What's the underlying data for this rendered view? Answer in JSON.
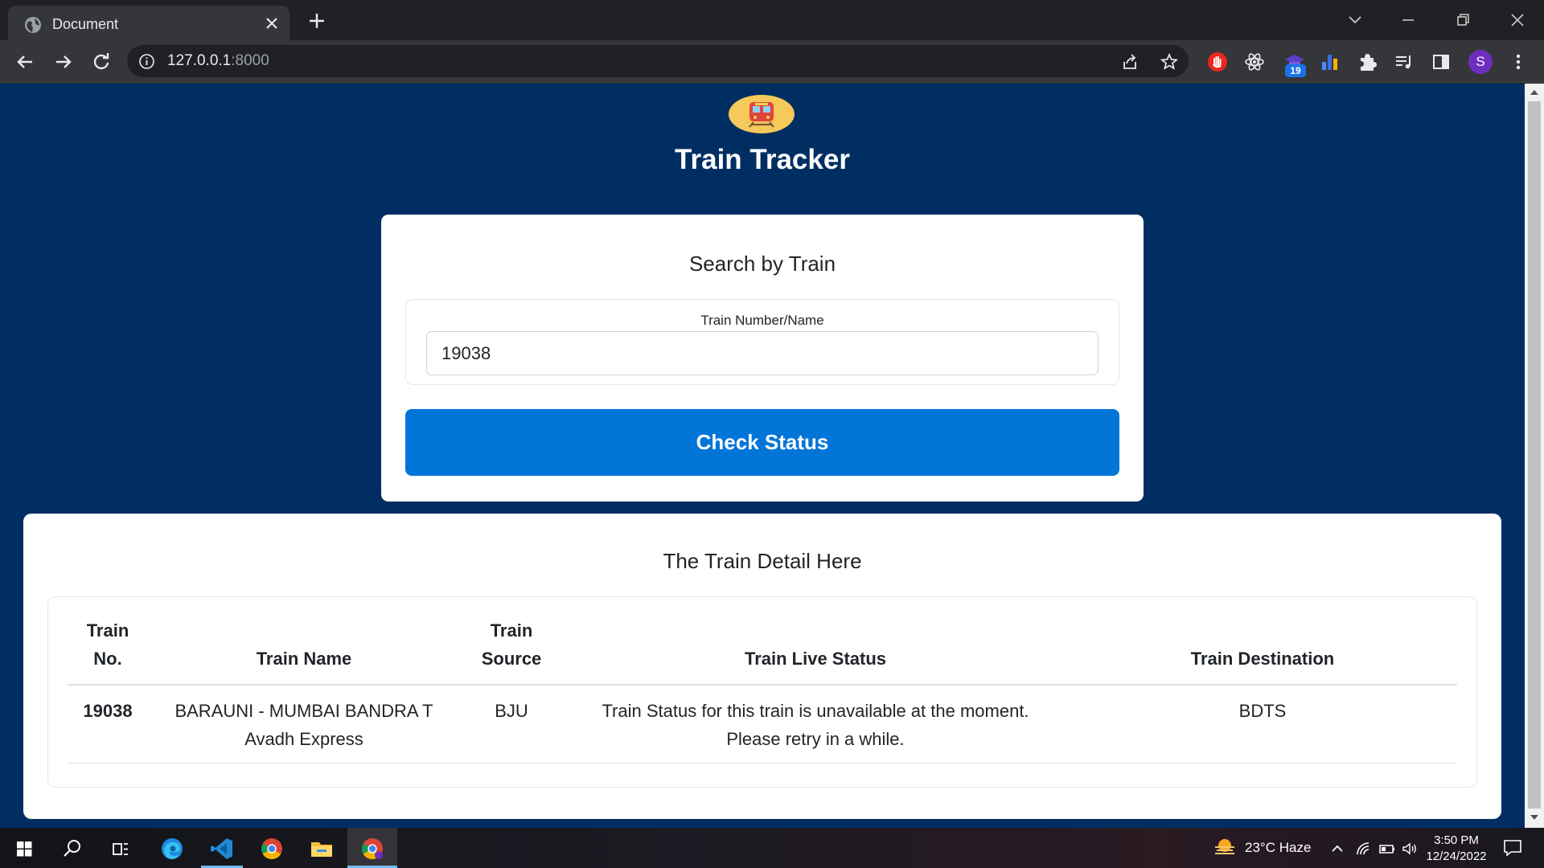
{
  "browser": {
    "tab_title": "Document",
    "url_host": "127.0.0.1",
    "url_port": ":8000",
    "profile_initial": "S",
    "extension_badge": "19"
  },
  "app": {
    "title": "Train Tracker"
  },
  "search": {
    "title": "Search by Train",
    "label": "Train Number/Name",
    "value": "19038",
    "button_label": "Check Status"
  },
  "details": {
    "title": "The Train Detail Here",
    "columns": [
      "Train No.",
      "Train Name",
      "Train Source",
      "Train Live Status",
      "Train Destination"
    ],
    "rows": [
      {
        "number": "19038",
        "name": "BARAUNI - MUMBAI BANDRA T Avadh Express",
        "source": "BJU",
        "status": "Train Status for this train is unavailable at the moment. Please retry in a while.",
        "destination": "BDTS"
      }
    ]
  },
  "taskbar": {
    "weather": "23°C  Haze",
    "time": "3:50 PM",
    "date": "12/24/2022"
  },
  "colors": {
    "page_background": "#002e62",
    "primary_button": "#0275d8",
    "logo_circle": "#f5c95a"
  }
}
